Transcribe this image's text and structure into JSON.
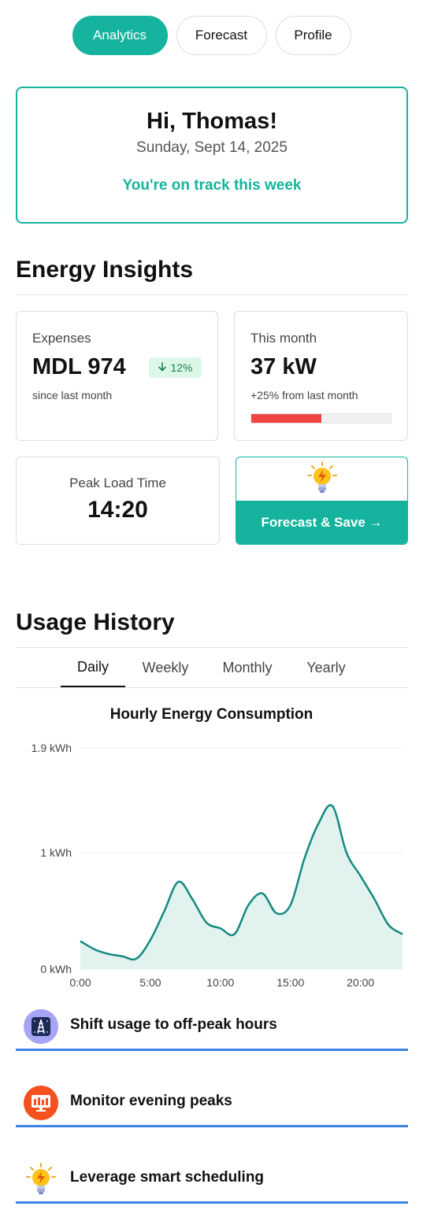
{
  "nav": {
    "tabs": [
      {
        "label": "Analytics",
        "active": true
      },
      {
        "label": "Forecast",
        "active": false
      },
      {
        "label": "Profile",
        "active": false
      }
    ]
  },
  "greeting": {
    "name": "Hi, Thomas!",
    "date": "Sunday, Sept 14, 2025",
    "status": "You're on track this week"
  },
  "insights": {
    "title": "Energy Insights",
    "expenses": {
      "label": "Expenses",
      "value": "MDL 974",
      "change": "12%",
      "change_direction": "down",
      "sub": "since last month"
    },
    "month": {
      "label": "This month",
      "value": "37 kW",
      "sub": "+25% from last month",
      "progress": 0.5
    },
    "peak": {
      "label": "Peak Load Time",
      "value": "14:20"
    },
    "forecast_button": "Forecast & Save →",
    "forecast_icon": "lightbulb-icon"
  },
  "usage": {
    "title": "Usage History",
    "tabs": [
      {
        "label": "Daily",
        "active": true
      },
      {
        "label": "Weekly",
        "active": false
      },
      {
        "label": "Monthly",
        "active": false
      },
      {
        "label": "Yearly",
        "active": false
      }
    ]
  },
  "chart_data": {
    "type": "area",
    "title": "Hourly Energy Consumption",
    "x": [
      0,
      1,
      2,
      3,
      4,
      5,
      6,
      7,
      8,
      9,
      10,
      11,
      12,
      13,
      14,
      15,
      16,
      17,
      18,
      19,
      20,
      21,
      22,
      23
    ],
    "values": [
      0.24,
      0.17,
      0.13,
      0.11,
      0.09,
      0.25,
      0.5,
      0.75,
      0.6,
      0.4,
      0.35,
      0.3,
      0.55,
      0.65,
      0.48,
      0.55,
      0.95,
      1.25,
      1.4,
      1.0,
      0.8,
      0.6,
      0.38,
      0.3
    ],
    "xticks": [
      {
        "x": 0,
        "label": "0:00"
      },
      {
        "x": 5,
        "label": "5:00"
      },
      {
        "x": 10,
        "label": "10:00"
      },
      {
        "x": 15,
        "label": "15:00"
      },
      {
        "x": 20,
        "label": "20:00"
      }
    ],
    "yticks": [
      {
        "y": 0,
        "label": "0 kWh"
      },
      {
        "y": 1,
        "label": "1 kWh"
      },
      {
        "y": 1.9,
        "label": "1.9 kWh"
      }
    ],
    "ylim": [
      0,
      1.9
    ],
    "xlim": [
      0,
      23
    ],
    "grid": true,
    "line_color": "#138a80",
    "fill_color": "#e2f2ef"
  },
  "tips": [
    {
      "text": "Shift usage to off-peak hours",
      "icon": "power-tower-icon",
      "bg": "#a7a3f5"
    },
    {
      "text": "Monitor evening peaks",
      "icon": "monitor-chart-icon",
      "bg": "#f4511e"
    },
    {
      "text": "Leverage smart scheduling",
      "icon": "lightbulb-icon",
      "bg": "#ffffff"
    }
  ],
  "colors": {
    "accent": "#15b39e",
    "danger": "#ef4444",
    "tip_border": "#3b82e6"
  }
}
